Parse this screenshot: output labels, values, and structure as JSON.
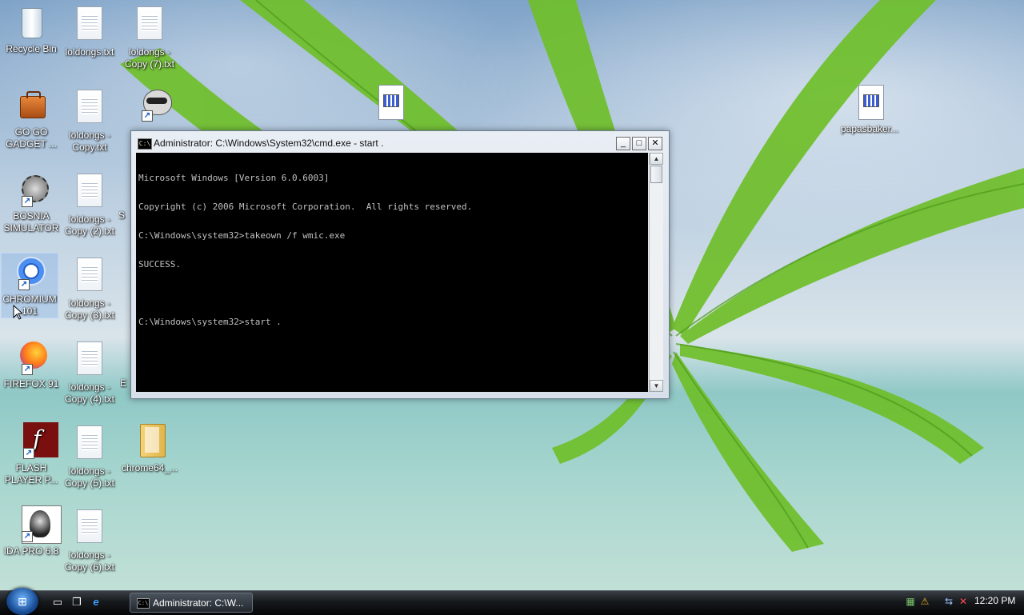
{
  "desktop": {
    "icons": [
      {
        "label": "Recycle Bin",
        "icon": "recycle-bin-icon"
      },
      {
        "label": "loldongs.txt",
        "icon": "text-file-icon"
      },
      {
        "label": "loldongs - Copy (7).txt",
        "icon": "text-file-icon"
      },
      {
        "label": "GO GO GADGET ...",
        "icon": "gadget-briefcase-icon"
      },
      {
        "label": "loldongs - Copy.txt",
        "icon": "text-file-icon"
      },
      {
        "label": "",
        "icon": "raccoon-icon"
      },
      {
        "label": "",
        "icon": "application-icon"
      },
      {
        "label": "papasbaker...",
        "icon": "application-icon"
      },
      {
        "label": "BOSNIA SIMULATOR",
        "icon": "gear-mace-icon"
      },
      {
        "label": "loldongs - Copy (2).txt",
        "icon": "text-file-icon"
      },
      {
        "label": "CHROMIUM 101",
        "icon": "chromium-icon"
      },
      {
        "label": "loldongs - Copy (3).txt",
        "icon": "text-file-icon"
      },
      {
        "label": "FIREFOX 91",
        "icon": "firefox-icon"
      },
      {
        "label": "loldongs - Copy (4).txt",
        "icon": "text-file-icon"
      },
      {
        "label": "FLASH PLAYER P...",
        "icon": "flash-player-icon"
      },
      {
        "label": "loldongs - Copy (5).txt",
        "icon": "text-file-icon"
      },
      {
        "label": "chrome64_...",
        "icon": "folder-icon"
      },
      {
        "label": "IDA PRO 6.8",
        "icon": "ida-pro-icon"
      },
      {
        "label": "loldongs - Copy (6).txt",
        "icon": "text-file-icon"
      }
    ],
    "partial_labels": {
      "s1": "S",
      "b1": "E"
    }
  },
  "cmd_window": {
    "title": "Administrator: C:\\Windows\\System32\\cmd.exe - start .",
    "icon_label": "C:\\",
    "minimize": "_",
    "maximize": "□",
    "close": "✕",
    "lines": [
      "Microsoft Windows [Version 6.0.6003]",
      "Copyright (c) 2006 Microsoft Corporation.  All rights reserved.",
      "C:\\Windows\\system32>takeown /f wmic.exe",
      "SUCCESS.",
      "",
      "C:\\Windows\\system32>start ."
    ],
    "scroll_up": "▲",
    "scroll_down": "▼"
  },
  "taskbar": {
    "start_glyph": "⊞",
    "quick_launch": [
      {
        "name": "show-desktop-icon",
        "glyph": "▭"
      },
      {
        "name": "switch-windows-icon",
        "glyph": "❐"
      },
      {
        "name": "internet-explorer-icon",
        "glyph": "e"
      }
    ],
    "task_button": "Administrator: C:\\W...",
    "task_icon": "C:\\",
    "tray": [
      {
        "name": "network-tray-icon",
        "glyph": "▦"
      },
      {
        "name": "security-alert-icon",
        "glyph": "⚠"
      },
      {
        "name": "connection-icon",
        "glyph": "⇆"
      },
      {
        "name": "volume-muted-icon",
        "glyph": "✕"
      }
    ],
    "clock": "12:20 PM"
  }
}
